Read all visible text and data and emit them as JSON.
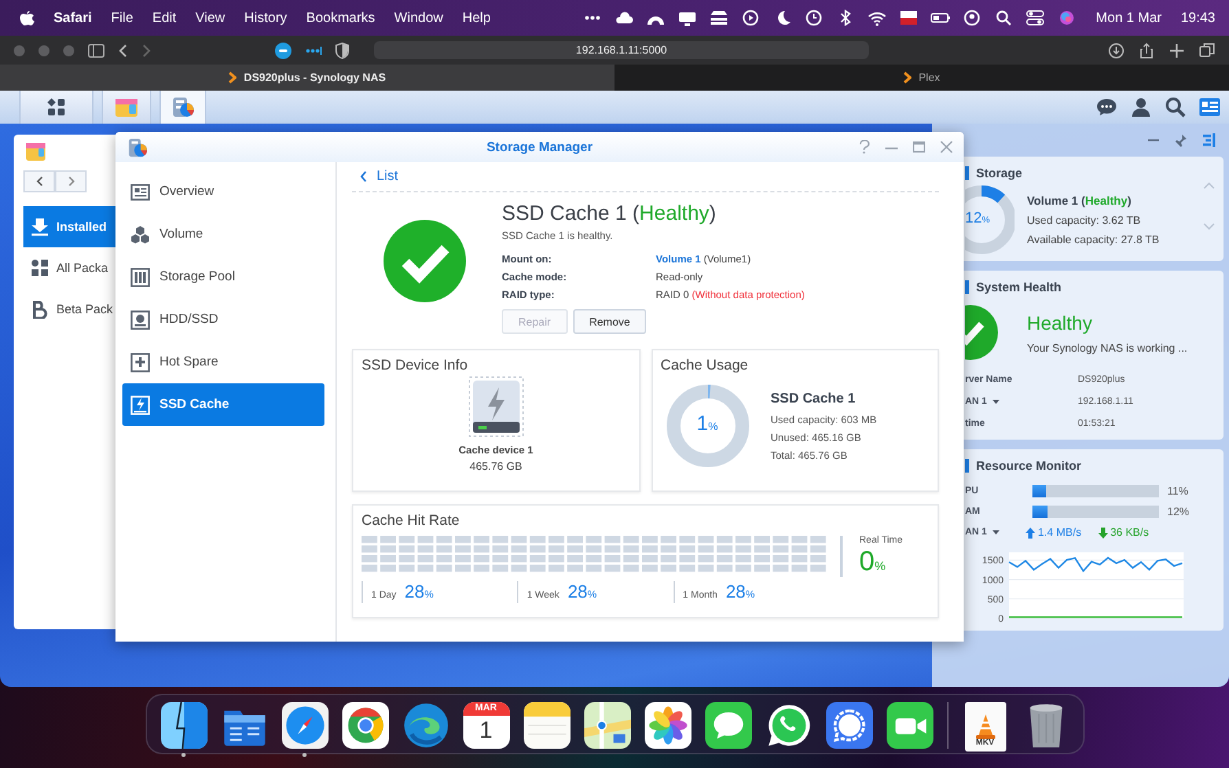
{
  "menubar": {
    "app": "Safari",
    "menus": [
      "File",
      "Edit",
      "View",
      "History",
      "Bookmarks",
      "Window",
      "Help"
    ],
    "date": "Mon 1 Mar",
    "time": "19:43"
  },
  "browser": {
    "url": "192.168.1.11:5000",
    "tabs": [
      {
        "label": "DS920plus - Synology NAS",
        "selected": true
      },
      {
        "label": "Plex",
        "selected": false
      }
    ]
  },
  "package_center": {
    "items": [
      {
        "label": "Installed",
        "kind": "download",
        "selected": true
      },
      {
        "label": "All Packa",
        "kind": "grid",
        "selected": false
      },
      {
        "label": "Beta Pack",
        "kind": "beta",
        "selected": false
      }
    ]
  },
  "storage_manager": {
    "title": "Storage Manager",
    "nav": [
      {
        "label": "Overview",
        "kind": "overview",
        "selected": false
      },
      {
        "label": "Volume",
        "kind": "volume",
        "selected": false
      },
      {
        "label": "Storage Pool",
        "kind": "pool",
        "selected": false
      },
      {
        "label": "HDD/SSD",
        "kind": "disk",
        "selected": false
      },
      {
        "label": "Hot Spare",
        "kind": "spare",
        "selected": false
      },
      {
        "label": "SSD Cache",
        "kind": "cache",
        "selected": true
      }
    ],
    "back": "List",
    "heading": [
      {
        "text": "SSD Cache 1 (",
        "kind": "plain"
      },
      {
        "text": "Healthy",
        "kind": "good"
      },
      {
        "text": ")",
        "kind": "plain"
      }
    ],
    "summary": "SSD Cache 1 is healthy.",
    "details": [
      {
        "label": "Mount on:",
        "value": [
          {
            "text": "Volume 1",
            "kind": "link"
          },
          {
            "text": " (Volume1)",
            "kind": "plain"
          }
        ]
      },
      {
        "label": "Cache mode:",
        "value": [
          {
            "text": "Read-only",
            "kind": "plain"
          }
        ]
      },
      {
        "label": "RAID type:",
        "value": [
          {
            "text": "RAID 0 ",
            "kind": "plain"
          },
          {
            "text": "(Without data protection)",
            "kind": "warning"
          }
        ]
      }
    ],
    "buttons": [
      {
        "label": "Repair",
        "disabled": true
      },
      {
        "label": "Remove",
        "disabled": false
      }
    ],
    "device_info": {
      "title": "SSD Device Info",
      "device": "Cache device 1",
      "size": "465.76 GB"
    },
    "cache_usage": {
      "title": "Cache Usage",
      "level": 0.01,
      "percent": "1",
      "unit": "%",
      "name": "SSD Cache 1",
      "lines": [
        "Used capacity: 603 MB",
        "Unused: 465.16 GB",
        "Total: 465.76 GB"
      ]
    },
    "hit_rate": {
      "title": "Cache Hit Rate",
      "real_time_label": "Real Time",
      "real_time": "0",
      "real_time_unit": "%",
      "periods": [
        {
          "label": "1 Day",
          "value": "28",
          "unit": "%"
        },
        {
          "label": "1 Week",
          "value": "28",
          "unit": "%"
        },
        {
          "label": "1 Month",
          "value": "28",
          "unit": "%"
        }
      ]
    }
  },
  "widgets": {
    "storage": {
      "title": "Storage",
      "level": 0.12,
      "percent": "12",
      "unit": "%",
      "volume": [
        {
          "text": "Volume 1 (",
          "kind": "plain"
        },
        {
          "text": "Healthy",
          "kind": "good"
        },
        {
          "text": ")",
          "kind": "plain"
        }
      ],
      "lines": [
        "Used capacity: 3.62 TB",
        "Available capacity: 27.8 TB"
      ]
    },
    "system_health": {
      "title": "System Health",
      "status": "Healthy",
      "message": "Your Synology NAS is working ...",
      "rows": [
        {
          "label": "rver Name",
          "value": "DS920plus",
          "dropdown": false
        },
        {
          "label": "AN 1",
          "value": "192.168.1.11",
          "dropdown": true
        },
        {
          "label": "time",
          "value": "01:53:21",
          "dropdown": false
        }
      ]
    },
    "resource_monitor": {
      "title": "Resource Monitor",
      "meters": [
        {
          "label": "PU",
          "level": 0.11,
          "reading": "11%"
        },
        {
          "label": "AM",
          "level": 0.12,
          "reading": "12%"
        }
      ],
      "network": {
        "label": "AN 1",
        "dropdown": true,
        "upload": "1.4 MB/s",
        "download": "36 KB/s"
      },
      "chart_data": {
        "type": "line",
        "grid": true,
        "ylim": [
          0,
          1700
        ],
        "yticks": [
          0,
          500,
          1000,
          1500
        ],
        "series": [
          {
            "color": "#1e88e5",
            "values": [
              1450,
              1320,
              1480,
              1250,
              1400,
              1530,
              1300,
              1500,
              1550,
              1220,
              1460,
              1380,
              1560,
              1420,
              1500,
              1300,
              1450,
              1250,
              1480,
              1520,
              1350,
              1420
            ]
          },
          {
            "color": "#2db82d",
            "values": [
              30,
              30,
              30,
              30,
              30,
              30,
              30,
              30,
              30,
              30,
              30,
              30,
              30,
              30,
              30,
              30,
              30,
              30,
              30,
              30,
              30,
              30
            ]
          }
        ]
      }
    }
  },
  "dock": {
    "apps": [
      {
        "kind": "finder",
        "running": true
      },
      {
        "kind": "files",
        "running": false
      },
      {
        "kind": "safari",
        "running": true
      },
      {
        "kind": "chrome",
        "running": false
      },
      {
        "kind": "edge",
        "running": false
      },
      {
        "kind": "calendar",
        "month": "MAR",
        "day": "1",
        "running": false
      },
      {
        "kind": "notes",
        "running": false
      },
      {
        "kind": "maps",
        "running": false
      },
      {
        "kind": "photos",
        "running": false
      },
      {
        "kind": "messages",
        "running": false
      },
      {
        "kind": "whatsapp",
        "running": false
      },
      {
        "kind": "signal",
        "running": false
      },
      {
        "kind": "facetime",
        "running": false
      }
    ],
    "files": [
      {
        "kind": "video_file",
        "label": "MKV",
        "running": false
      },
      {
        "kind": "trash",
        "running": false
      }
    ]
  }
}
